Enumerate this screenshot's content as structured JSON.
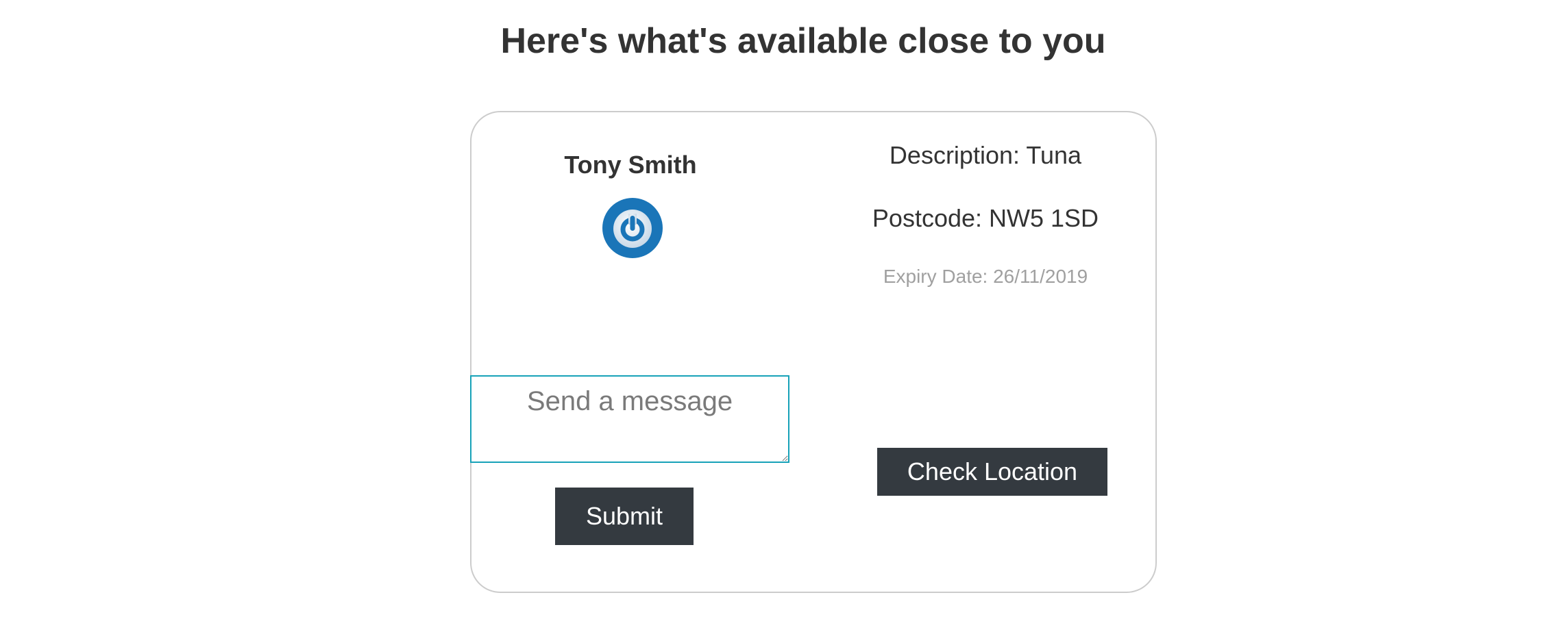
{
  "page": {
    "title": "Here's what's available close to you"
  },
  "listing": {
    "owner_name": "Tony Smith",
    "avatar_icon": "power-icon",
    "description": "Description: Tuna",
    "postcode": "Postcode: NW5 1SD",
    "expiry": "Expiry Date: 26/11/2019",
    "message_placeholder": "Send a message",
    "submit_label": "Submit",
    "check_location_label": "Check Location"
  },
  "colors": {
    "button_bg": "#343a40",
    "input_border": "#17a2b8",
    "avatar_blue": "#1a75b8",
    "expiry_text": "#a0a0a0"
  }
}
